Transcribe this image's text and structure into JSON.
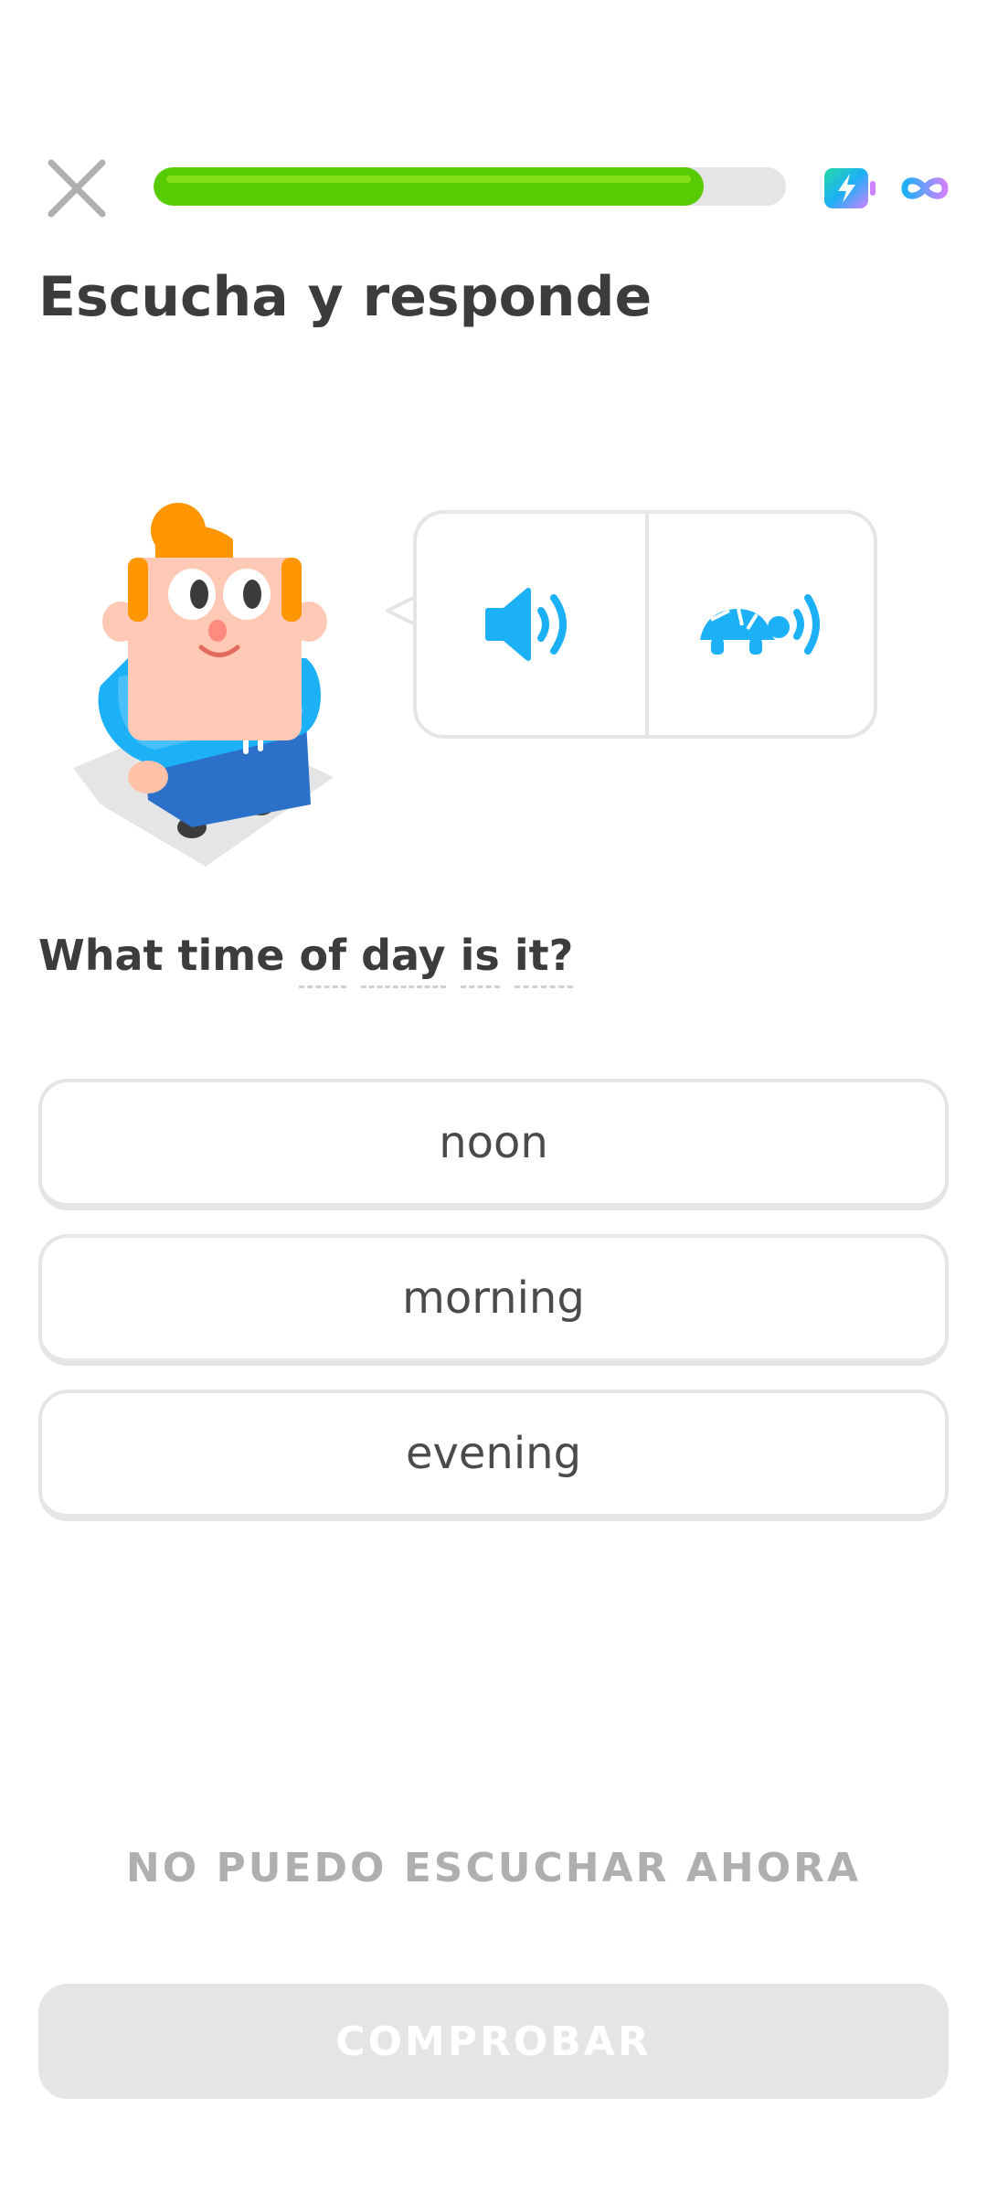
{
  "header": {
    "progress_fraction": 0.87,
    "icons": [
      "close-icon",
      "boost-icon",
      "infinity-icon"
    ]
  },
  "challenge": {
    "title": "Escucha y responde",
    "question_words": [
      "What",
      "time",
      "of",
      "day",
      "is",
      "it?"
    ],
    "hinted_words": [
      "of",
      "day",
      "is",
      "it?"
    ]
  },
  "audio": {
    "normal_icon": "speaker-icon",
    "slow_icon": "turtle-speaker-icon"
  },
  "options": [
    {
      "label": "noon"
    },
    {
      "label": "morning"
    },
    {
      "label": "evening"
    }
  ],
  "footer": {
    "cant_listen_label": "NO PUEDO ESCUCHAR AHORA",
    "check_label": "COMPROBAR"
  },
  "colors": {
    "progress": "#58cc02",
    "audio_blue": "#1cb0f6",
    "border": "#e5e5e5",
    "disabled_text": "#afafaf"
  }
}
